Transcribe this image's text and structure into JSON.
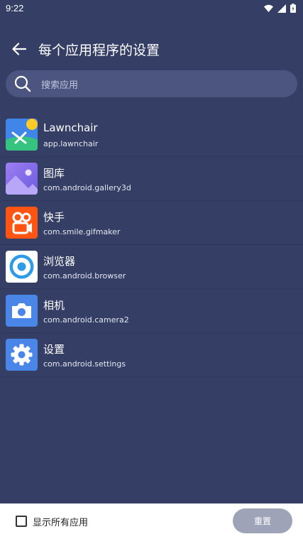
{
  "status_bar": {
    "time": "9:22"
  },
  "header": {
    "title": "每个应用程序的设置"
  },
  "search": {
    "placeholder": "搜索应用"
  },
  "apps": [
    {
      "name": "Lawnchair",
      "package": "app.lawnchair",
      "icon": "lawnchair-icon"
    },
    {
      "name": "图库",
      "package": "com.android.gallery3d",
      "icon": "gallery-icon"
    },
    {
      "name": "快手",
      "package": "com.smile.gifmaker",
      "icon": "kuaishou-icon"
    },
    {
      "name": "浏览器",
      "package": "com.android.browser",
      "icon": "browser-icon"
    },
    {
      "name": "相机",
      "package": "com.android.camera2",
      "icon": "camera-icon"
    },
    {
      "name": "设置",
      "package": "com.android.settings",
      "icon": "settings-icon"
    }
  ],
  "footer": {
    "show_all_label": "显示所有应用",
    "show_all_checked": false,
    "reset_label": "重置"
  },
  "colors": {
    "background": "#353f66",
    "search_bg": "#4c5580",
    "reset_bg": "#9ea3b8"
  }
}
